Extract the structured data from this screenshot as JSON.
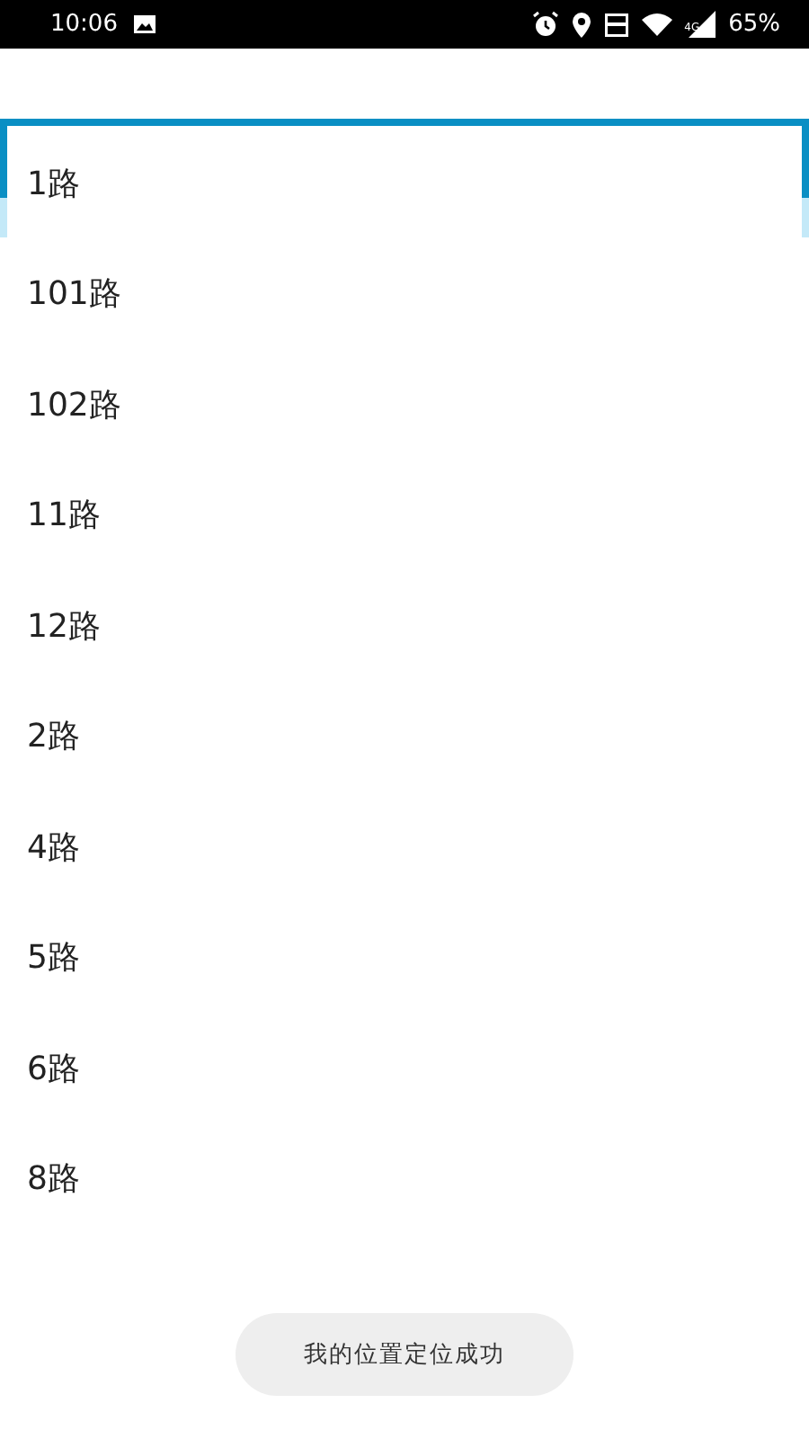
{
  "status_bar": {
    "time": "10:06",
    "network": "4G",
    "battery": "65%"
  },
  "route_list": {
    "items": [
      {
        "label": "1路"
      },
      {
        "label": "101路"
      },
      {
        "label": "102路"
      },
      {
        "label": "11路"
      },
      {
        "label": "12路"
      },
      {
        "label": "2路"
      },
      {
        "label": "4路"
      },
      {
        "label": "5路"
      },
      {
        "label": "6路"
      },
      {
        "label": "8路"
      }
    ]
  },
  "toast": {
    "text": "我的位置定位成功"
  }
}
